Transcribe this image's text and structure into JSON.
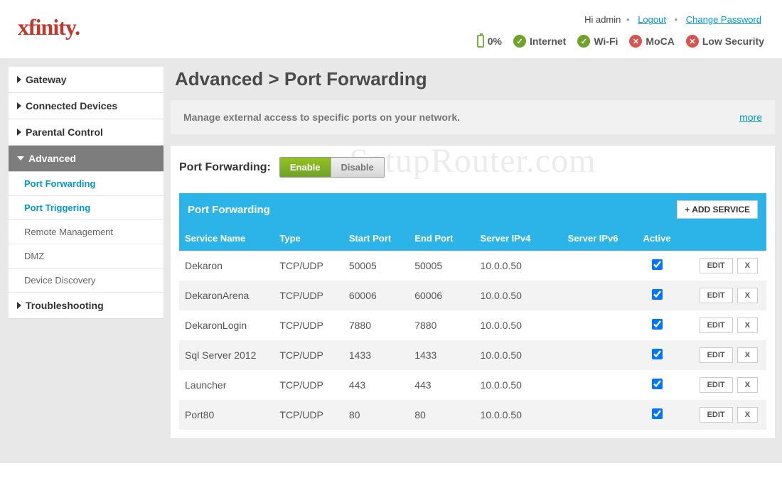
{
  "header": {
    "logo": "xfinity",
    "greeting": "Hi admin",
    "logout": "Logout",
    "change_password": "Change Password",
    "battery_pct": "0%",
    "status": [
      {
        "label": "Internet",
        "state": "ok"
      },
      {
        "label": "Wi-Fi",
        "state": "ok"
      },
      {
        "label": "MoCA",
        "state": "err"
      },
      {
        "label": "Low Security",
        "state": "err"
      }
    ]
  },
  "sidebar": {
    "items": [
      {
        "label": "Gateway"
      },
      {
        "label": "Connected Devices"
      },
      {
        "label": "Parental Control"
      },
      {
        "label": "Advanced",
        "active": true,
        "children": [
          {
            "label": "Port Forwarding",
            "highlight": true
          },
          {
            "label": "Port Triggering",
            "highlight": true
          },
          {
            "label": "Remote Management"
          },
          {
            "label": "DMZ"
          },
          {
            "label": "Device Discovery"
          }
        ]
      },
      {
        "label": "Troubleshooting"
      }
    ]
  },
  "page": {
    "title": "Advanced > Port Forwarding",
    "description": "Manage external access to specific ports on your network.",
    "more": "more",
    "watermark": "SetupRouter.com"
  },
  "port_forwarding": {
    "label": "Port Forwarding:",
    "enable": "Enable",
    "disable": "Disable",
    "table_title": "Port Forwarding",
    "add_service": "+ ADD SERVICE",
    "edit_label": "EDIT",
    "delete_label": "X",
    "columns": {
      "service_name": "Service Name",
      "type": "Type",
      "start_port": "Start Port",
      "end_port": "End Port",
      "server_ipv4": "Server IPv4",
      "server_ipv6": "Server IPv6",
      "active": "Active"
    },
    "rows": [
      {
        "name": "Dekaron",
        "type": "TCP/UDP",
        "start": "50005",
        "end": "50005",
        "ipv4": "10.0.0.50",
        "ipv6": "",
        "active": true
      },
      {
        "name": "DekaronArena",
        "type": "TCP/UDP",
        "start": "60006",
        "end": "60006",
        "ipv4": "10.0.0.50",
        "ipv6": "",
        "active": true
      },
      {
        "name": "DekaronLogin",
        "type": "TCP/UDP",
        "start": "7880",
        "end": "7880",
        "ipv4": "10.0.0.50",
        "ipv6": "",
        "active": true
      },
      {
        "name": "Sql Server 2012",
        "type": "TCP/UDP",
        "start": "1433",
        "end": "1433",
        "ipv4": "10.0.0.50",
        "ipv6": "",
        "active": true
      },
      {
        "name": "Launcher",
        "type": "TCP/UDP",
        "start": "443",
        "end": "443",
        "ipv4": "10.0.0.50",
        "ipv6": "",
        "active": true
      },
      {
        "name": "Port80",
        "type": "TCP/UDP",
        "start": "80",
        "end": "80",
        "ipv4": "10.0.0.50",
        "ipv6": "",
        "active": true
      }
    ]
  }
}
